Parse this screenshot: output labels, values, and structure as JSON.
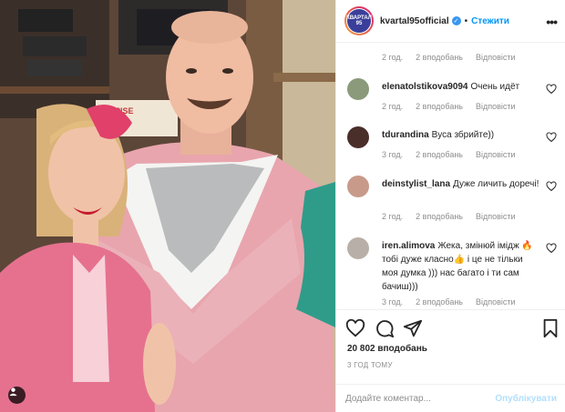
{
  "post": {
    "owner": "kvartal95official",
    "avatar_text": "КВАРТАЛ 95",
    "follow_label": "Стежити",
    "separator": "•",
    "likes": "20 802 вподобань",
    "time_ago": "3 ГОД ТОМУ",
    "photo_sign_text": "SPISE",
    "colors": {
      "accent": "#0095f6",
      "muted": "#8e8e8e",
      "publish_disabled": "#b2dffc",
      "verified": "#3897f0"
    }
  },
  "top_meta": {
    "time": "2 год.",
    "likes": "2 вподобань",
    "reply": "Відповісти"
  },
  "comments": [
    {
      "user": "elenatolstikova9094",
      "text": "Очень идёт",
      "time": "2 год.",
      "likes": "2 вподобань",
      "reply": "Відповісти",
      "avatar_color": "#8a9a7a"
    },
    {
      "user": "tdurandina",
      "text": "Вуса збрийте))",
      "time": "3 год.",
      "likes": "2 вподобань",
      "reply": "Відповісти",
      "avatar_color": "#4a2e2a"
    },
    {
      "user": "deinstylist_lana",
      "text": "Дуже личить доречі!",
      "time": "2 год.",
      "likes": "2 вподобань",
      "reply": "Відповісти",
      "avatar_color": "#c89a8a"
    },
    {
      "user": "iren.alimova",
      "text": "Жека, змінюй імідж 🔥 тобі дуже класно👍 і це не тільки моя думка ))) нас багато і ти сам бачиш)))",
      "time": "3 год.",
      "likes": "2 вподобань",
      "reply": "Відповісти",
      "avatar_color": "#b8b0a8"
    }
  ],
  "add_comment": {
    "placeholder": "Додайте коментар...",
    "publish_label": "Опублікувати"
  },
  "icons": [
    "more-icon",
    "verified-icon",
    "heart-icon",
    "comment-icon",
    "share-icon",
    "bookmark-icon",
    "user-tag-icon"
  ]
}
